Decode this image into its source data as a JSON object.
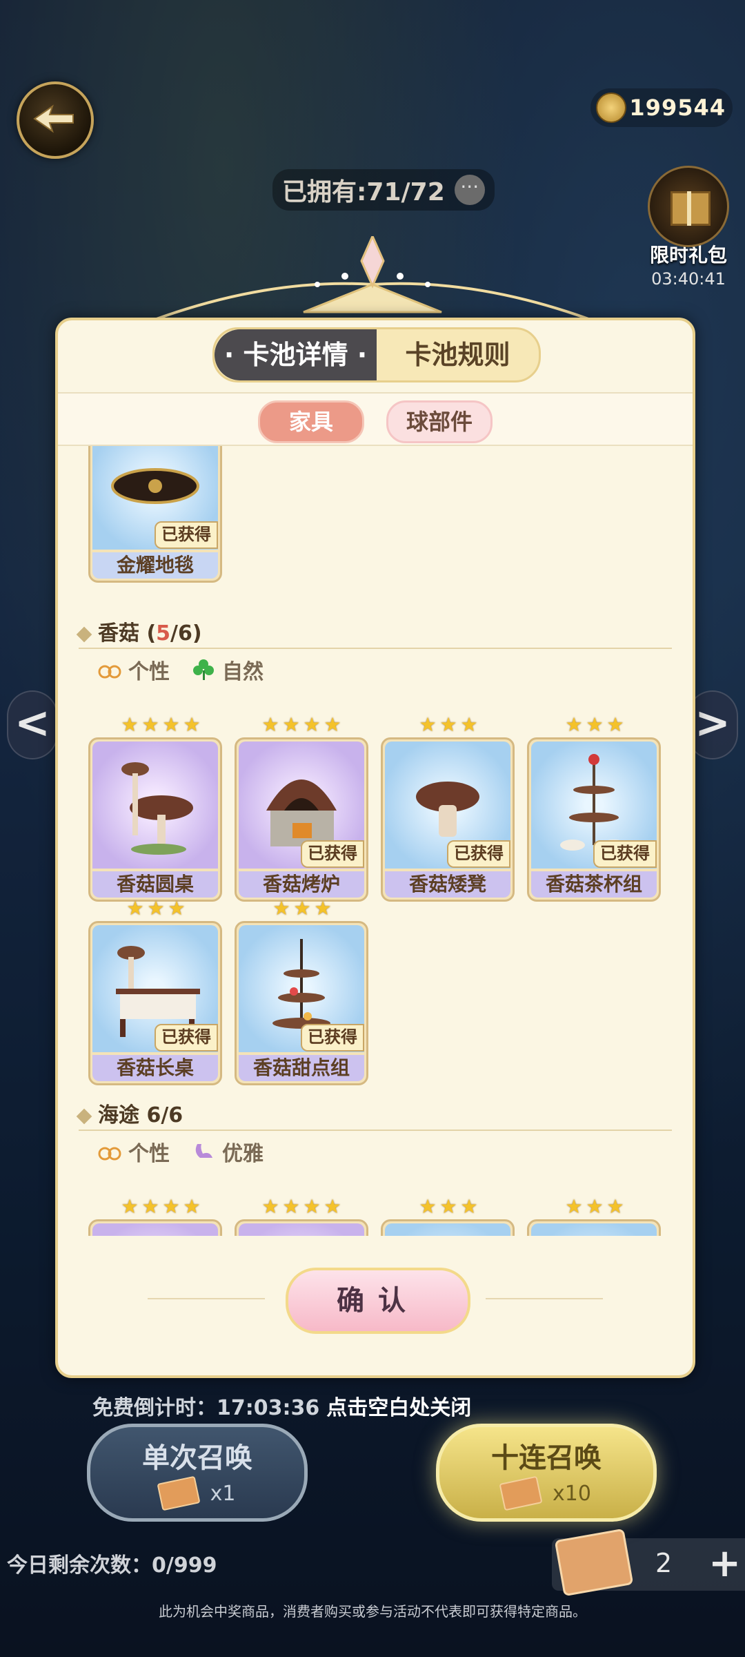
{
  "header": {
    "currency_amount": "199544",
    "owned_label": "已拥有:71/72",
    "gift": {
      "label": "限时礼包",
      "timer": "03:40:41"
    }
  },
  "panel": {
    "tabs": [
      {
        "label": "· 卡池详情 ·",
        "active": true
      },
      {
        "label": "卡池规则",
        "active": false
      }
    ],
    "subtabs": [
      {
        "label": "家具",
        "active": true
      },
      {
        "label": "球部件",
        "active": false
      }
    ],
    "top_card": {
      "name": "金耀地毯",
      "obtained_label": "已获得"
    },
    "sections": [
      {
        "title_prefix": "香菇 (",
        "owned": "5",
        "title_suffix": "/6)",
        "tags": [
          "个性",
          "自然"
        ],
        "items": [
          {
            "name": "香菇圆桌",
            "stars": 4,
            "obtained": false
          },
          {
            "name": "香菇烤炉",
            "stars": 4,
            "obtained": true
          },
          {
            "name": "香菇矮凳",
            "stars": 3,
            "obtained": true
          },
          {
            "name": "香菇茶杯组",
            "stars": 3,
            "obtained": true
          },
          {
            "name": "香菇长桌",
            "stars": 3,
            "obtained": true
          },
          {
            "name": "香菇甜点组",
            "stars": 3,
            "obtained": true
          }
        ]
      },
      {
        "title": "海途 6/6",
        "tags": [
          "个性",
          "优雅"
        ],
        "partial_star_counts": [
          4,
          4,
          3,
          3
        ]
      }
    ],
    "obtained_label": "已获得",
    "confirm_label": "确认"
  },
  "footer": {
    "free_countdown": "免费倒计时：17:03:36",
    "close_hint": "点击空白处关闭",
    "single_summon": {
      "label": "单次召唤",
      "qty": "x1"
    },
    "ten_summon": {
      "label": "十连召唤",
      "qty": "x10"
    },
    "remaining": "今日剩余次数：0/999",
    "ticket_count": "2",
    "plus": "+",
    "disclaimer": "此为机会中奖商品，消费者购买或参与活动不代表即可获得特定商品。"
  },
  "nav": {
    "left_arrow": "<",
    "right_arrow": ">"
  },
  "colors": {
    "accent_gold": "#e7cf8c",
    "highlight_red": "#d85a4a",
    "active_tab": "#4c4a4e"
  }
}
